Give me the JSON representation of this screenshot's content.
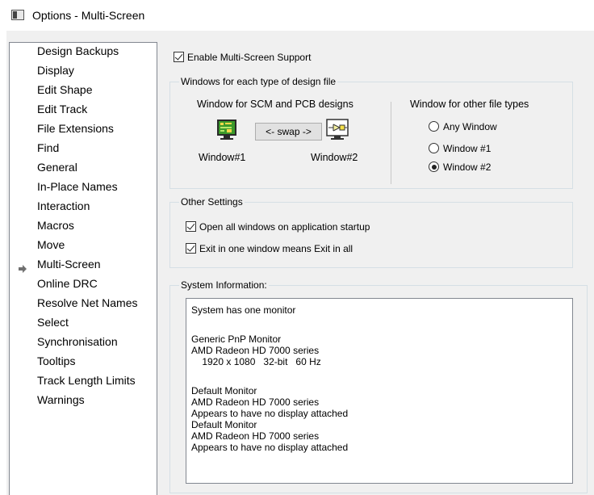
{
  "window": {
    "title": "Options - Multi-Screen"
  },
  "nav": {
    "items": [
      "Design Backups",
      "Display",
      "Edit Shape",
      "Edit Track",
      "File Extensions",
      "Find",
      "General",
      "In-Place Names",
      "Interaction",
      "Macros",
      "Move",
      "Multi-Screen",
      "Online DRC",
      "Resolve Net Names",
      "Select",
      "Synchronisation",
      "Tooltips",
      "Track Length Limits",
      "Warnings"
    ],
    "selected": "Multi-Screen"
  },
  "enable_multiscreen": {
    "label": "Enable Multi-Screen Support",
    "checked": true
  },
  "windows_group": {
    "legend": "Windows for each type of design file",
    "scm_pcb_title": "Window for SCM and PCB designs",
    "swap_label": "<- swap ->",
    "window1_label": "Window#1",
    "window2_label": "Window#2",
    "other_title": "Window for other file types",
    "radio_any": "Any Window",
    "radio_w1": "Window #1",
    "radio_w2": "Window #2",
    "selected_radio": "Window #2"
  },
  "other_settings": {
    "legend": "Other Settings",
    "open_all": {
      "label": "Open all windows on application startup",
      "checked": true
    },
    "exit_all": {
      "label": "Exit in one window means Exit in all",
      "checked": true
    }
  },
  "system_info": {
    "legend": "System Information:",
    "lines": [
      "System has one monitor",
      "",
      "Generic PnP Monitor",
      "AMD Radeon HD 7000 series",
      "    1920 x 1080   32-bit   60 Hz",
      "",
      "Default Monitor",
      "AMD Radeon HD 7000 series",
      "Appears to have no display attached",
      "Default Monitor",
      "AMD Radeon HD 7000 series",
      "Appears to have no display attached"
    ]
  },
  "icons": {
    "pcb_icon": "pcb-board-icon",
    "scm_icon": "schematic-icon",
    "selected_arrow": "arrow-right-icon"
  }
}
